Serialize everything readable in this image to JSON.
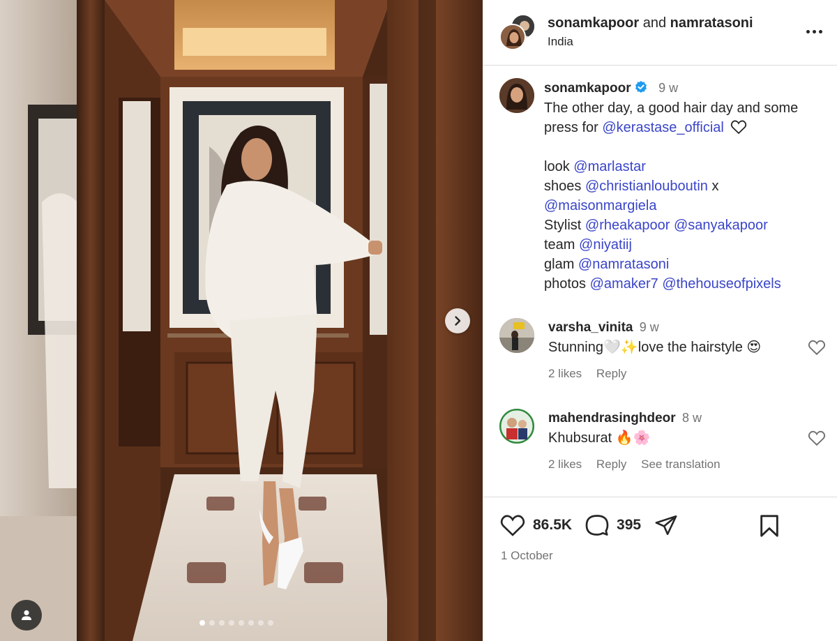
{
  "post": {
    "header": {
      "user1": "sonamkapoor",
      "joiner": "and",
      "user2": "namratasoni",
      "location": "India"
    },
    "caption": {
      "username": "sonamkapoor",
      "time": "9 w",
      "line1": "The other day, a good hair day and some",
      "line2_prefix": "press for",
      "line2_mention": "@kerastase_official",
      "look_label": "look",
      "look_mention": "@marlastar",
      "shoes_label": "shoes",
      "shoes_mention1": "@christianlouboutin",
      "shoes_x": "x",
      "shoes_mention2": "@maisonmargiela",
      "stylist_label": "Stylist",
      "stylist_mention1": "@rheakapoor",
      "stylist_mention2": "@sanyakapoor",
      "team_label": "team",
      "team_mention": "@niyatiij",
      "glam_label": "glam",
      "glam_mention": "@namratasoni",
      "photos_label": "photos",
      "photos_mention1": "@amaker7",
      "photos_mention2": "@thehouseofpixels"
    },
    "comments": [
      {
        "username": "varsha_vinita",
        "time": "9 w",
        "text": "Stunning🤍✨love the hairstyle 😍",
        "likes": "2 likes",
        "reply": "Reply"
      },
      {
        "username": "mahendrasinghdeor",
        "time": "8 w",
        "text": "Khubsurat 🔥🌸",
        "likes": "2 likes",
        "reply": "Reply",
        "translate": "See translation"
      }
    ],
    "stats": {
      "likes": "86.5K",
      "comments": "395"
    },
    "date": "1 October",
    "carousel": {
      "total": 8,
      "current": 1
    }
  },
  "icons": {
    "more": "more-options-icon",
    "verified": "verified-badge-icon",
    "heart": "heart-icon",
    "comment": "comment-icon",
    "share": "share-icon",
    "save": "bookmark-icon",
    "next": "chevron-right-icon",
    "tag": "user-tag-icon"
  },
  "colors": {
    "mention": "#3a45c8",
    "verified": "#1d9bf0",
    "text": "#262626",
    "muted": "#737373"
  }
}
